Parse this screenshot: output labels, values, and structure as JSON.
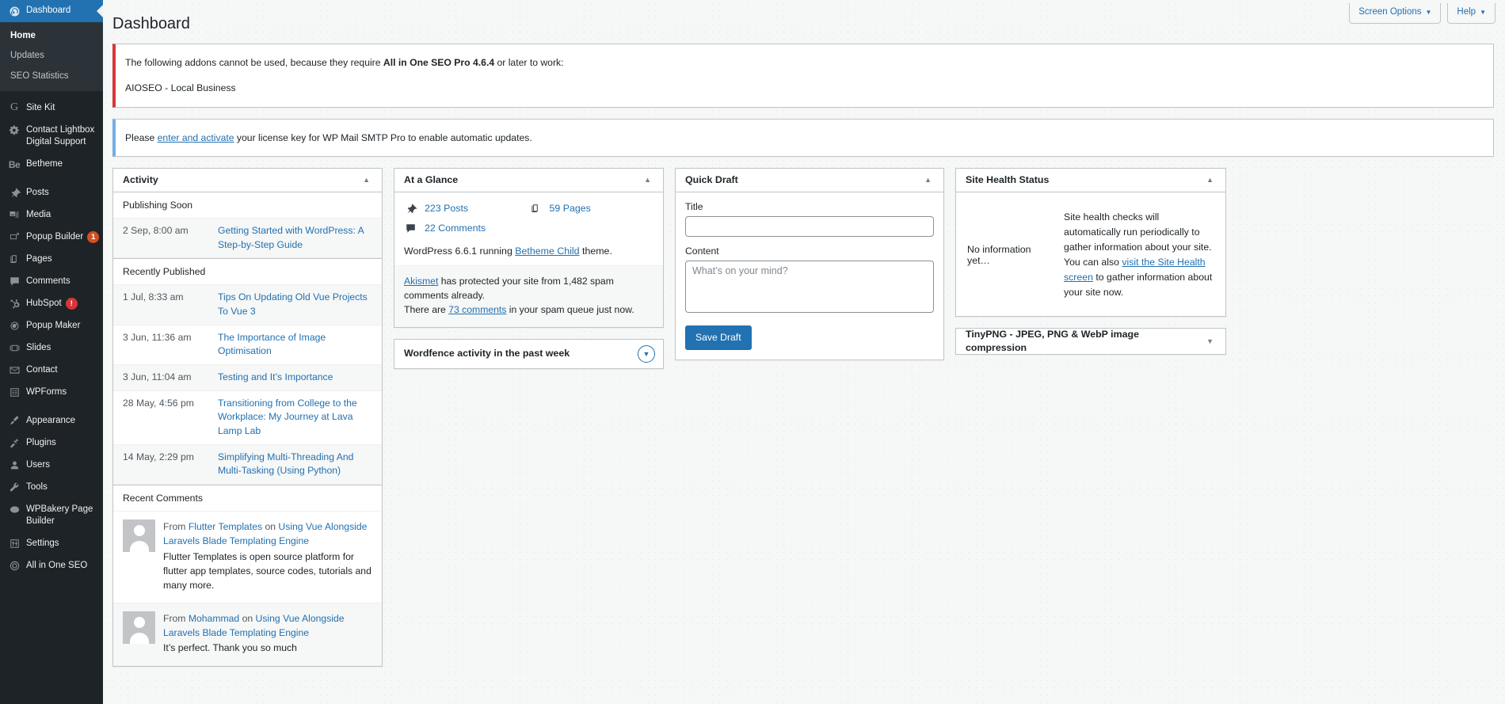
{
  "sidebar": {
    "items": [
      {
        "label": "Dashboard",
        "icon": "dashboard-icon",
        "current": true,
        "submenu": [
          {
            "label": "Home",
            "current": true
          },
          {
            "label": "Updates",
            "current": false
          },
          {
            "label": "SEO Statistics",
            "current": false
          }
        ]
      },
      {
        "label": "Site Kit",
        "icon": "google-g-icon"
      },
      {
        "label": "Contact Lightbox Digital Support",
        "icon": "gear-icon"
      },
      {
        "label": "Betheme",
        "icon": "betheme-icon"
      },
      {
        "label": "Posts",
        "icon": "pin-icon"
      },
      {
        "label": "Media",
        "icon": "media-icon"
      },
      {
        "label": "Popup Builder",
        "icon": "popup-builder-icon",
        "badge": "1",
        "badge_color": "orange"
      },
      {
        "label": "Pages",
        "icon": "pages-icon"
      },
      {
        "label": "Comments",
        "icon": "comment-bubble-icon"
      },
      {
        "label": "HubSpot",
        "icon": "hubspot-icon",
        "badge": "!",
        "badge_color": "red"
      },
      {
        "label": "Popup Maker",
        "icon": "popup-maker-icon"
      },
      {
        "label": "Slides",
        "icon": "slides-icon"
      },
      {
        "label": "Contact",
        "icon": "envelope-icon"
      },
      {
        "label": "WPForms",
        "icon": "wpforms-icon"
      },
      {
        "label": "Appearance",
        "icon": "paintbrush-icon"
      },
      {
        "label": "Plugins",
        "icon": "plug-icon"
      },
      {
        "label": "Users",
        "icon": "user-icon"
      },
      {
        "label": "Tools",
        "icon": "wrench-icon"
      },
      {
        "label": "WPBakery Page Builder",
        "icon": "wpbakery-icon"
      },
      {
        "label": "Settings",
        "icon": "sliders-icon"
      },
      {
        "label": "All in One SEO",
        "icon": "aioseo-icon"
      }
    ]
  },
  "screen_meta": {
    "screen_options": "Screen Options",
    "help": "Help",
    "caret": "▼"
  },
  "page": {
    "title": "Dashboard"
  },
  "notices": [
    {
      "type": "error",
      "line1_pre": "The following addons cannot be used, because they require ",
      "line1_bold": "All in One SEO Pro 4.6.4",
      "line1_post": " or later to work:",
      "line2": "AIOSEO - Local Business"
    },
    {
      "type": "info",
      "pre": "Please ",
      "link": "enter and activate",
      "post": " your license key for WP Mail SMTP Pro to enable automatic updates."
    }
  ],
  "activity": {
    "title": "Activity",
    "toggle": "▲",
    "publishing_soon_label": "Publishing Soon",
    "publishing_soon": [
      {
        "time": "2 Sep, 8:00 am",
        "title": "Getting Started with WordPress: A Step-by-Step Guide"
      }
    ],
    "recently_published_label": "Recently Published",
    "recently_published": [
      {
        "time": "1 Jul, 8:33 am",
        "title": "Tips On Updating Old Vue Projects To Vue 3"
      },
      {
        "time": "3 Jun, 11:36 am",
        "title": "The Importance of Image Optimisation"
      },
      {
        "time": "3 Jun, 11:04 am",
        "title": "Testing and It’s Importance"
      },
      {
        "time": "28 May, 4:56 pm",
        "title": "Transitioning from College to the Workplace: My Journey at Lava Lamp Lab"
      },
      {
        "time": "14 May, 2:29 pm",
        "title": "Simplifying Multi-Threading And Multi-Tasking (Using Python)"
      }
    ],
    "recent_comments_label": "Recent Comments",
    "comments": [
      {
        "from_label": "From",
        "author": "Flutter Templates",
        "on_label": "on",
        "post": "Using Vue Alongside Laravels Blade Templating Engine",
        "excerpt": "Flutter Templates is open source platform for flutter app templates, source codes, tutorials and many more."
      },
      {
        "from_label": "From",
        "author": "Mohammad",
        "on_label": "on",
        "post": "Using Vue Alongside Laravels Blade Templating Engine",
        "excerpt": "It’s perfect. Thank you so much"
      }
    ]
  },
  "at_a_glance": {
    "title": "At a Glance",
    "toggle": "▲",
    "items": [
      {
        "icon": "pin-icon",
        "label": "223 Posts"
      },
      {
        "icon": "pages-icon",
        "label": "59 Pages"
      },
      {
        "icon": "comment-bubble-icon",
        "label": "22 Comments"
      }
    ],
    "version_pre": "WordPress 6.6.1 running ",
    "version_theme": "Betheme Child",
    "version_post": " theme.",
    "akismet_link": "Akismet",
    "akismet_text": " has protected your site from 1,482 spam comments already.",
    "spam_pre": "There are ",
    "spam_link": "73 comments",
    "spam_post": " in your spam queue just now."
  },
  "wordfence": {
    "title": "Wordfence activity in the past week",
    "toggle": "▼"
  },
  "quick_draft": {
    "title": "Quick Draft",
    "toggle": "▲",
    "title_label": "Title",
    "title_value": "",
    "title_placeholder": "",
    "content_label": "Content",
    "content_value": "",
    "content_placeholder": "What’s on your mind?",
    "save_label": "Save Draft"
  },
  "site_health": {
    "title": "Site Health Status",
    "toggle": "▲",
    "no_info": "No information yet…",
    "desc_pre": "Site health checks will automatically run periodically to gather information about your site. You can also ",
    "desc_link": "visit the Site Health screen",
    "desc_post": " to gather information about your site now."
  },
  "tinypng": {
    "title": "TinyPNG - JPEG, PNG & WebP image compression",
    "toggle": "▼"
  },
  "colors": {
    "accent": "#2271b1",
    "sidebar_bg": "#1d2327",
    "error": "#d63638",
    "info": "#72aee6"
  }
}
